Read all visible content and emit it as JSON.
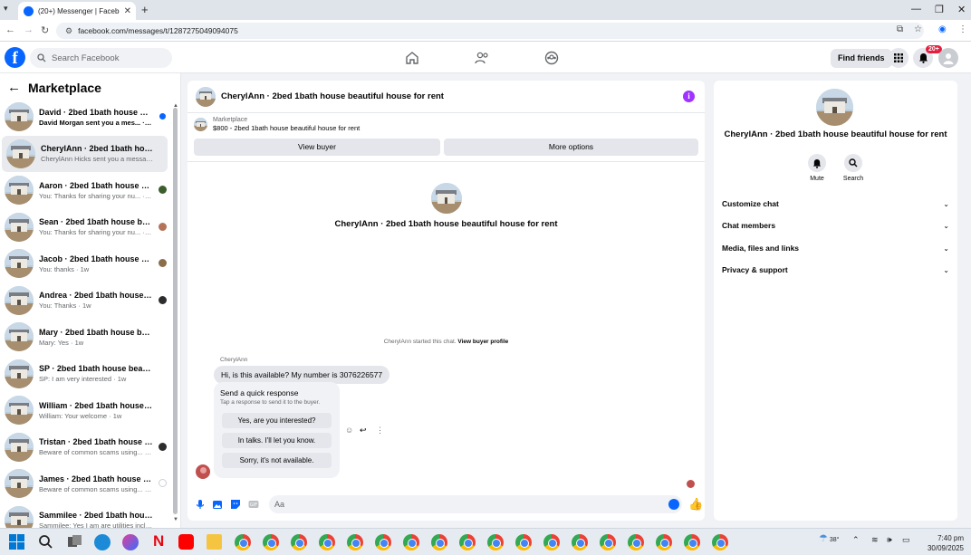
{
  "browser": {
    "tab_title": "(20+) Messenger | Facebook",
    "url": "facebook.com/messages/t/1287275049094075"
  },
  "header": {
    "search_placeholder": "Search Facebook",
    "find_friends_label": "Find friends",
    "notif_count": "20+"
  },
  "sidebar": {
    "title": "Marketplace",
    "conversations": [
      {
        "name": "David · 2bed 1bath house bea...",
        "preview": "David Morgan sent you a mes... · 42m",
        "unread": true
      },
      {
        "name": "CherylAnn · 2bed 1bath house b...",
        "preview": "CherylAnn Hicks sent you a messag... · 2h",
        "active": true
      },
      {
        "name": "Aaron · 2bed 1bath house bea...",
        "preview": "You: Thanks for sharing your nu... · 1w"
      },
      {
        "name": "Sean · 2bed 1bath house beau...",
        "preview": "You: Thanks for sharing your nu... · 1w"
      },
      {
        "name": "Jacob · 2bed 1bath house bea...",
        "preview": "You: thanks · 1w"
      },
      {
        "name": "Andrea · 2bed 1bath house be...",
        "preview": "You: Thanks · 1w"
      },
      {
        "name": "Mary · 2bed 1bath house beautif...",
        "preview": "Mary: Yes · 1w"
      },
      {
        "name": "SP · 2bed 1bath house beautiful ...",
        "preview": "SP: I am very interested · 1w"
      },
      {
        "name": "William · 2bed 1bath house bea...",
        "preview": "William: Your welcome · 1w"
      },
      {
        "name": "Tristan · 2bed 1bath house be...",
        "preview": "Beware of common scams using... · 2w"
      },
      {
        "name": "James · 2bed 1bath house bea...",
        "preview": "Beware of common scams using... · 2w"
      },
      {
        "name": "Sammilee · 2bed 1bath house be...",
        "preview": "Sammilee: Yes I am are utilities incl... · 2w"
      }
    ]
  },
  "chat": {
    "title": "CherylAnn · 2bed 1bath house beautiful house for rent",
    "marketplace_label": "Marketplace",
    "listing": "$800 - 2bed 1bath house beautiful house for rent",
    "view_buyer": "View buyer",
    "more_options": "More options",
    "profile_name": "CherylAnn · 2bed 1bath house beautiful house for rent",
    "started_text": "CherylAnn started this chat.",
    "view_profile_link": "View buyer profile",
    "sender": "CherylAnn",
    "message": "Hi, is this available? My number is 3076226577",
    "quick_response_title": "Send a quick response",
    "quick_response_sub": "Tap a response to send it to the buyer.",
    "quick_responses": [
      "Yes, are you interested?",
      "In talks. I'll let you know.",
      "Sorry, it's not available."
    ],
    "composer_placeholder": "Aa"
  },
  "info_panel": {
    "name": "CherylAnn · 2bed 1bath house beautiful house for rent",
    "mute_label": "Mute",
    "search_label": "Search",
    "sections": [
      "Customize chat",
      "Chat members",
      "Media, files and links",
      "Privacy & support"
    ]
  },
  "taskbar": {
    "temp": "38°",
    "time": "7:40 pm",
    "date": "30/09/2025"
  },
  "colors": {
    "fb_blue": "#0866ff",
    "info_purple": "#a033ff",
    "notif_red": "#e41e3f"
  }
}
